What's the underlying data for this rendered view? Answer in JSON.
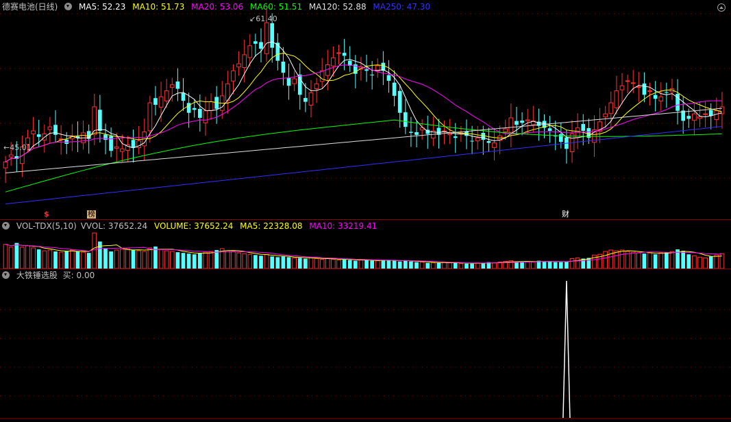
{
  "stock": {
    "name": "德赛电池(日线)"
  },
  "main_legend": [
    {
      "label": "MA5: 52.23",
      "color": "#ffffff"
    },
    {
      "label": "MA10: 51.73",
      "color": "#ffff00"
    },
    {
      "label": "MA20: 53.06",
      "color": "#ff00ff"
    },
    {
      "label": "MA60: 51.51",
      "color": "#00ff00"
    },
    {
      "label": "MA120: 52.88",
      "color": "#e0e0e0"
    },
    {
      "label": "MA250: 47.30",
      "color": "#3030ff"
    }
  ],
  "annotations": {
    "high": "61.40",
    "low": "45.01"
  },
  "markers": [
    {
      "label": "$",
      "color": "#ff3030"
    },
    {
      "label": "榜",
      "color": "#000000",
      "bg": "#e0b070"
    },
    {
      "label": "财",
      "color": "#ffffff"
    }
  ],
  "vol_legend": [
    {
      "label": "VOL-TDX(5,10)",
      "color": "#c0c0c0"
    },
    {
      "label": "VVOL: 37652.24",
      "color": "#c0c0c0"
    },
    {
      "label": "VOLUME: 37652.24",
      "color": "#ffff00"
    },
    {
      "label": "MA5: 22328.08",
      "color": "#ffff00"
    },
    {
      "label": "MA10: 33219.41",
      "color": "#ff00ff"
    }
  ],
  "ind_legend": [
    {
      "label": "大铁锤选股",
      "color": "#c0c0c0"
    },
    {
      "label": "买: 0.00",
      "color": "#c0c0c0"
    }
  ],
  "colors": {
    "up": "#ff3232",
    "down": "#54ffff",
    "grid": "#8b0000",
    "signal": "#ffffff"
  },
  "chart_data": {
    "type": "candlestick",
    "price_range": [
      42.8,
      62.3
    ],
    "closes": [
      47.5,
      48.2,
      47.8,
      49.0,
      49.9,
      50.6,
      50.0,
      50.3,
      51.0,
      50.2,
      49.8,
      49.3,
      50.1,
      49.9,
      50.4,
      49.8,
      53.0,
      50.6,
      49.7,
      48.6,
      49.0,
      48.8,
      49.2,
      48.9,
      49.6,
      50.5,
      53.4,
      53.2,
      54.0,
      54.6,
      55.2,
      54.8,
      53.6,
      52.4,
      52.7,
      51.9,
      52.6,
      53.5,
      52.8,
      54.1,
      55.3,
      56.6,
      57.3,
      58.2,
      59.1,
      59.3,
      58.8,
      61.4,
      58.9,
      57.6,
      56.4,
      55.1,
      55.8,
      54.2,
      53.5,
      54.4,
      55.3,
      56.6,
      57.2,
      57.9,
      58.4,
      58.1,
      57.1,
      56.3,
      57.0,
      56.6,
      56.2,
      57.1,
      56.6,
      55.6,
      54.1,
      52.4,
      51.0,
      50.4,
      50.2,
      50.9,
      50.3,
      50.6,
      50.2,
      50.6,
      50.3,
      49.9,
      50.4,
      50.1,
      49.6,
      49.9,
      49.7,
      49.4,
      49.4,
      50.1,
      50.8,
      51.9,
      51.2,
      51.4,
      51.7,
      51.6,
      51.1,
      50.9,
      50.6,
      50.1,
      49.5,
      48.8,
      50.3,
      50.9,
      50.6,
      49.9,
      50.7,
      51.5,
      52.3,
      53.4,
      54.6,
      55.1,
      55.6,
      55.4,
      55.0,
      54.2,
      54.6,
      53.8,
      54.0,
      54.4,
      54.8,
      52.6,
      51.6,
      51.8,
      52.3,
      52.0,
      52.3,
      52.1,
      52.6,
      53.0
    ],
    "volume": [
      34000,
      30000,
      36000,
      30000,
      32000,
      29000,
      27000,
      25000,
      26000,
      24000,
      23000,
      25000,
      26000,
      24000,
      23000,
      22000,
      50000,
      38000,
      28000,
      24000,
      26000,
      27000,
      28000,
      26000,
      25000,
      24000,
      29000,
      31000,
      27000,
      25000,
      24000,
      23000,
      22000,
      21000,
      20000,
      22000,
      23000,
      24000,
      26000,
      28000,
      25000,
      24000,
      22000,
      21000,
      20000,
      19000,
      18000,
      20000,
      17000,
      16000,
      17000,
      16000,
      15000,
      15000,
      14000,
      15000,
      14000,
      13000,
      14000,
      13000,
      12000,
      13000,
      12000,
      11000,
      12000,
      12000,
      11000,
      11000,
      12000,
      12000,
      11000,
      10000,
      11000,
      10000,
      9000,
      9000,
      8000,
      8000,
      8000,
      9000,
      8000,
      8000,
      7000,
      7000,
      7000,
      8000,
      8000,
      9000,
      8000,
      9000,
      10000,
      11000,
      10000,
      9000,
      10000,
      9000,
      11000,
      10000,
      10000,
      9000,
      9000,
      10000,
      14000,
      15000,
      14000,
      15000,
      19000,
      20000,
      24000,
      26000,
      25000,
      26000,
      24000,
      23000,
      22000,
      21000,
      22000,
      20000,
      22000,
      23000,
      24000,
      27000,
      25000,
      20000,
      18000,
      16000,
      15000,
      17000,
      19000,
      21000
    ],
    "signal_index": 101
  }
}
